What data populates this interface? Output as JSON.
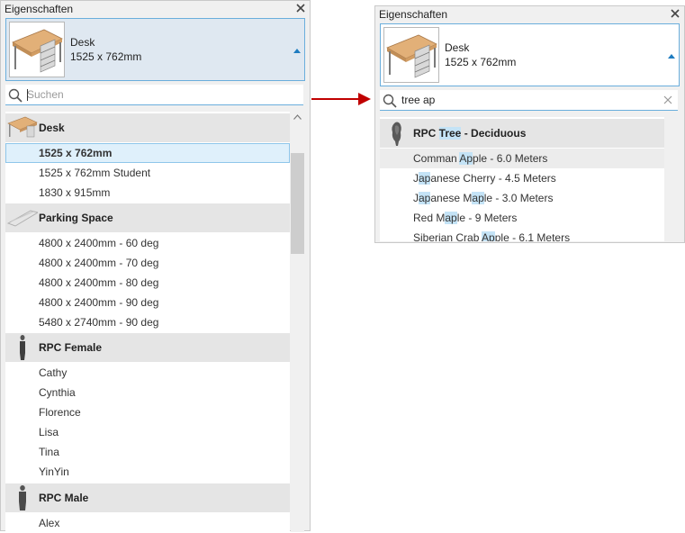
{
  "left": {
    "title": "Eigenschaften",
    "type_name": "Desk",
    "type_size": "1525 x 762mm",
    "search_placeholder": "Suchen",
    "groups": [
      {
        "label": "Desk",
        "items": [
          "1525 x 762mm",
          "1525 x 762mm Student",
          "1830 x 915mm"
        ]
      },
      {
        "label": "Parking Space",
        "items": [
          "4800 x 2400mm - 60 deg",
          "4800 x 2400mm - 70 deg",
          "4800 x 2400mm - 80 deg",
          "4800 x 2400mm - 90 deg",
          "5480 x 2740mm - 90 deg"
        ]
      },
      {
        "label": "RPC Female",
        "items": [
          "Cathy",
          "Cynthia",
          "Florence",
          "Lisa",
          "Tina",
          "YinYin"
        ]
      },
      {
        "label": "RPC Male",
        "items": [
          "Alex"
        ]
      }
    ],
    "selected_item": "1525 x 762mm"
  },
  "right": {
    "title": "Eigenschaften",
    "type_name": "Desk",
    "type_size": "1525 x 762mm",
    "search_value": "tree ap",
    "group": {
      "label_parts": [
        "RPC ",
        "Tree",
        " - Deciduous"
      ]
    },
    "items": [
      {
        "parts": [
          "Comman ",
          "Ap",
          "ple - 6.0 Meters"
        ]
      },
      {
        "parts": [
          "J",
          "ap",
          "anese Cherry - 4.5 Meters"
        ]
      },
      {
        "parts": [
          "J",
          "ap",
          "anese M",
          "ap",
          "le - 3.0 Meters"
        ]
      },
      {
        "parts": [
          "Red M",
          "ap",
          "le - 9 Meters"
        ]
      },
      {
        "parts": [
          "Siberian Crab ",
          "Ap",
          "ple - 6.1 Meters"
        ]
      }
    ]
  },
  "colors": {
    "accent": "#6aaedc",
    "highlight": "#c4e3f6",
    "selection": "#dff0fb",
    "arrow": "#c00000"
  },
  "icons": [
    "close-icon",
    "search-icon",
    "dropdown-arrow-icon",
    "clear-icon",
    "desk-icon",
    "parking-space-icon",
    "female-figure-icon",
    "male-figure-icon",
    "tree-icon",
    "scroll-up-icon"
  ]
}
